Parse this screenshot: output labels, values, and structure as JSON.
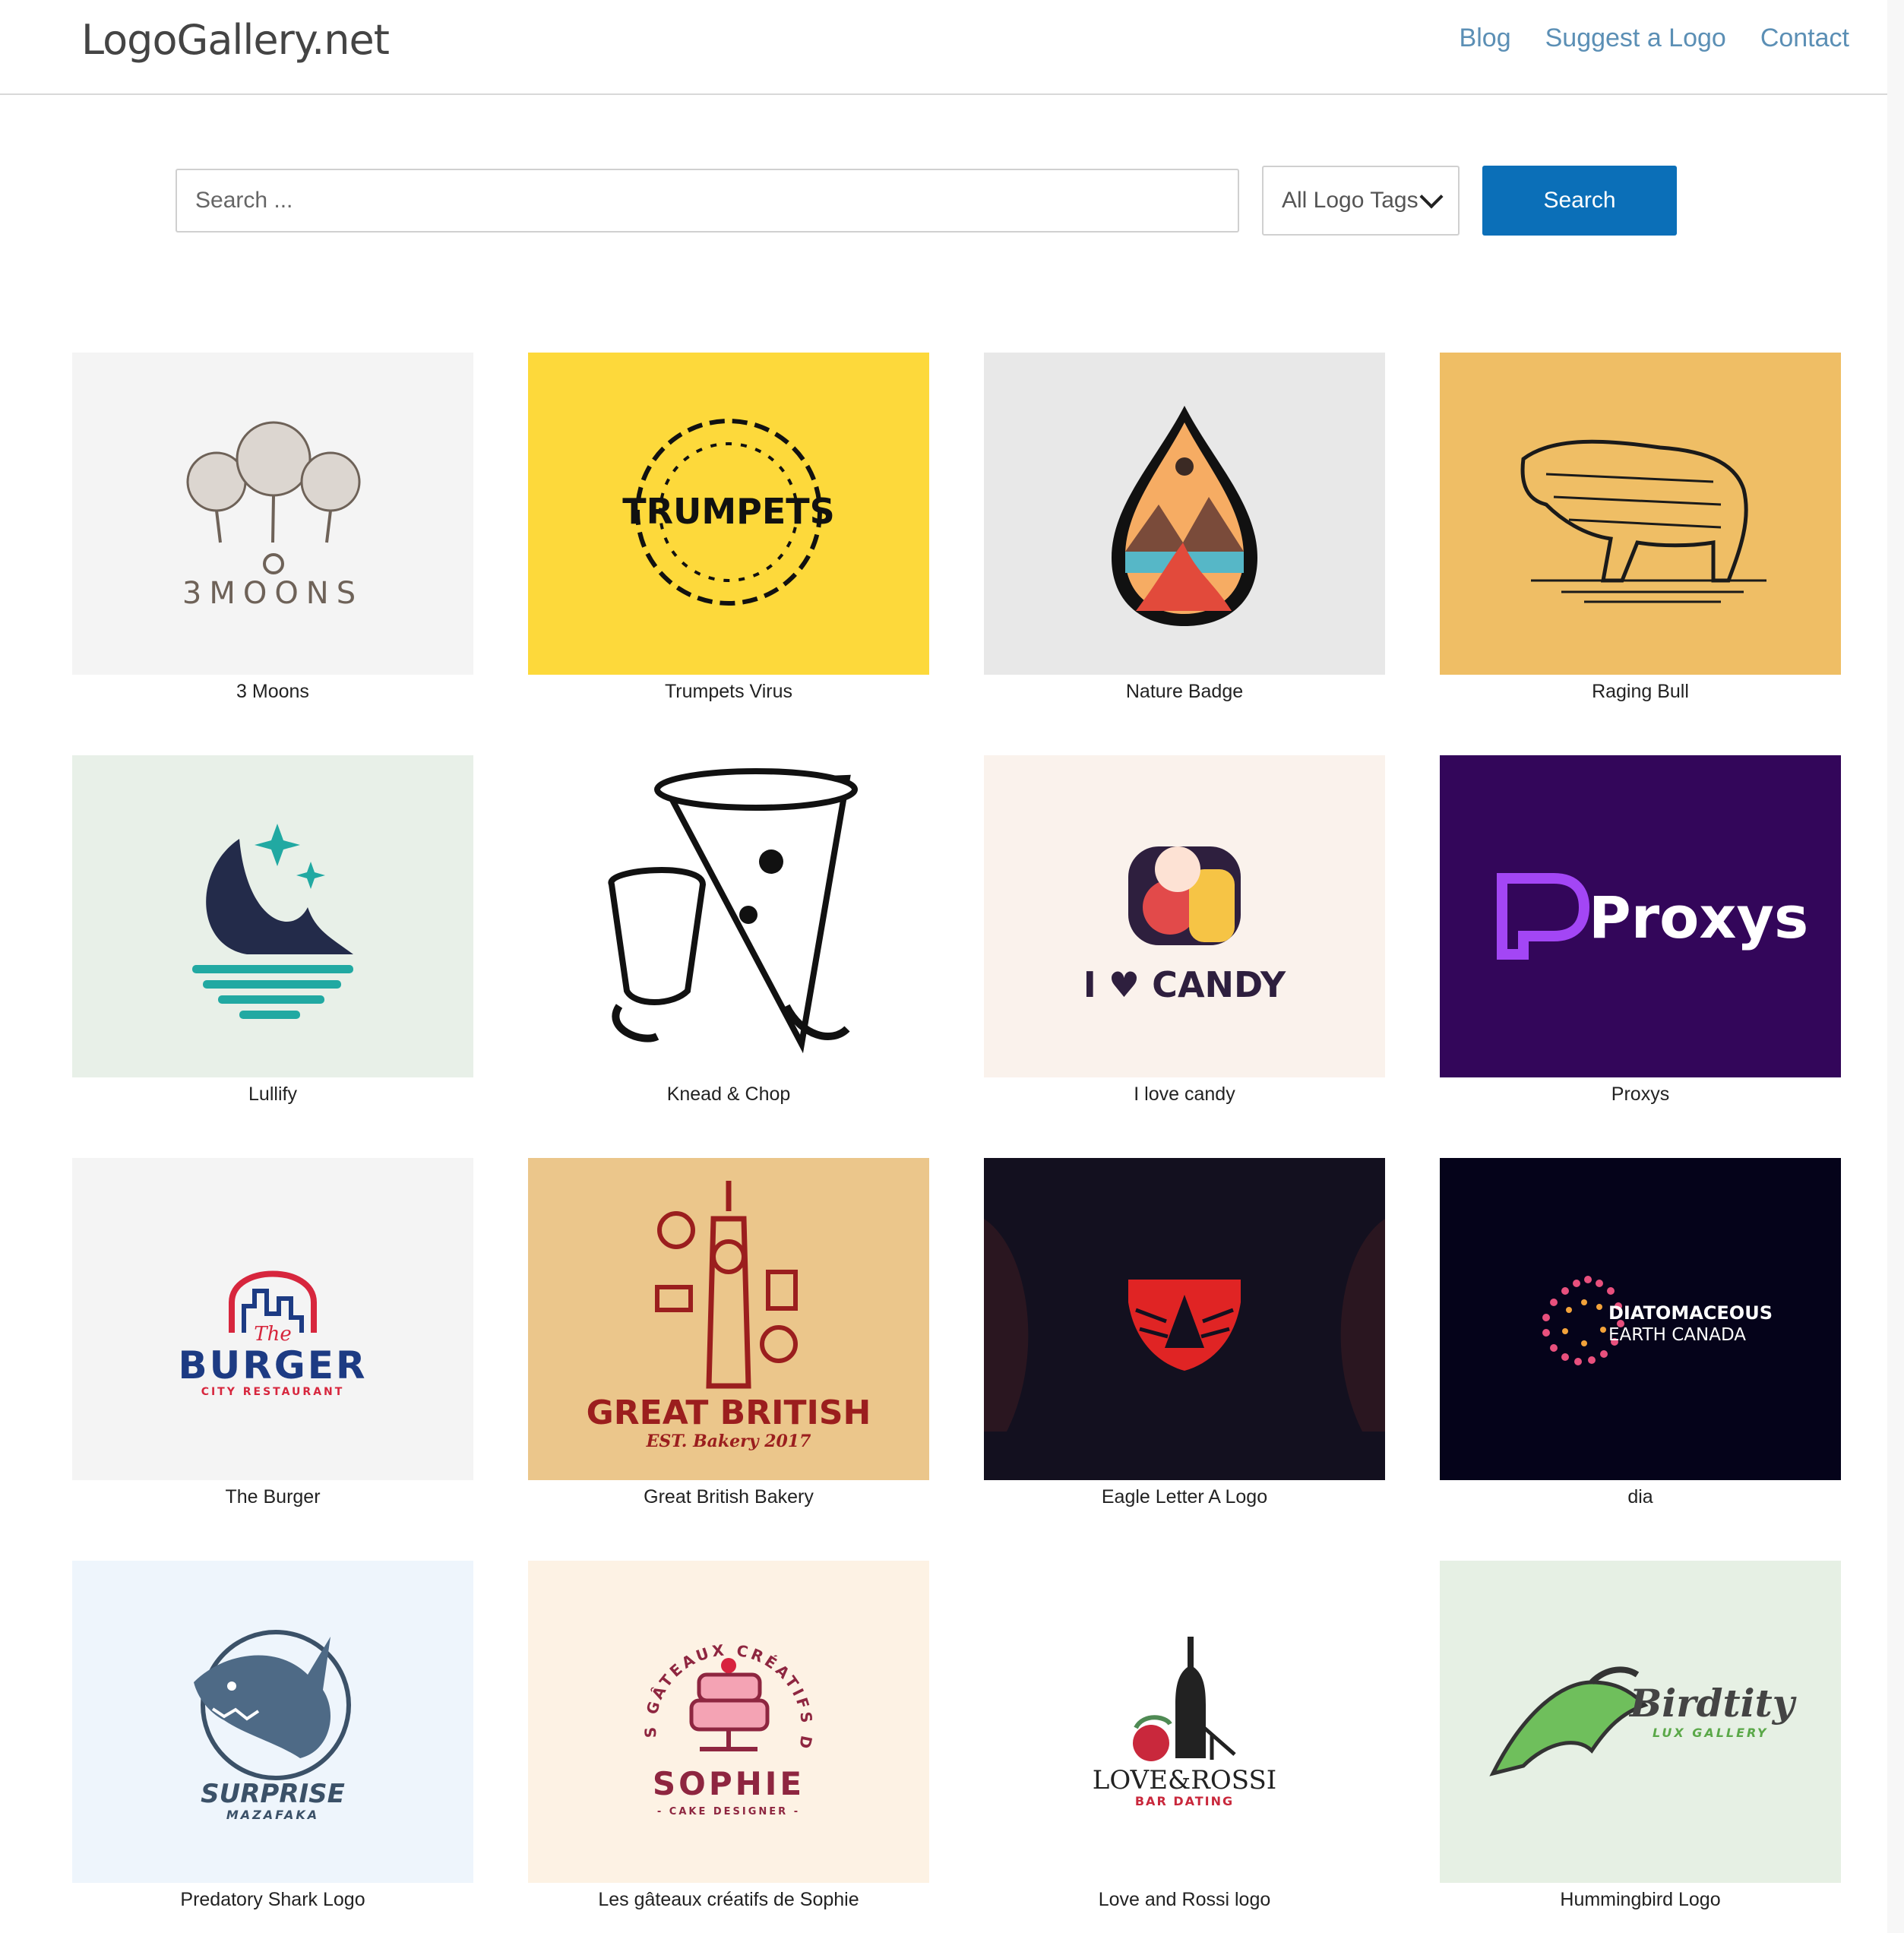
{
  "header": {
    "site_name": "LogoGallery.net",
    "nav": [
      "Blog",
      "Suggest a Logo",
      "Contact"
    ]
  },
  "search": {
    "placeholder": "Search ...",
    "tags_selected": "All Logo Tags",
    "button_label": "Search"
  },
  "logos": [
    {
      "title": "3 Moons",
      "bg": "#f4f4f4",
      "art": "3MOONS"
    },
    {
      "title": "Trumpets Virus",
      "bg": "#fdd93b",
      "art": "TRUMPETS"
    },
    {
      "title": "Nature Badge",
      "bg": "#e8e8e8",
      "art": ""
    },
    {
      "title": "Raging Bull",
      "bg": "#efbe65",
      "art": ""
    },
    {
      "title": "Lullify",
      "bg": "#e8f0e8",
      "art": ""
    },
    {
      "title": "Knead & Chop",
      "bg": "#ffffff",
      "art": ""
    },
    {
      "title": "I love candy",
      "bg": "#faf2ec",
      "art": "I ♥ CANDY"
    },
    {
      "title": "Proxys",
      "bg": "#33065a",
      "art": "Proxys"
    },
    {
      "title": "The Burger",
      "bg": "#f4f4f4",
      "art": "BURGER",
      "art_top": "The",
      "art_sub": "CITY RESTAURANT"
    },
    {
      "title": "Great British Bakery",
      "bg": "#ebc68b",
      "art": "GREAT BRITISH",
      "art_sub": "EST. Bakery 2017"
    },
    {
      "title": "Eagle Letter A Logo",
      "bg": "#13101f",
      "art": ""
    },
    {
      "title": "dia",
      "bg": "#05031a",
      "art": "DIATOMACEOUS",
      "art_sub": "EARTH CANADA"
    },
    {
      "title": "Predatory Shark Logo",
      "bg": "#eef5fc",
      "art": "SURPRISE",
      "art_sub": "MAZAFAKA"
    },
    {
      "title": "Les gâteaux créatifs de Sophie",
      "bg": "#fdf2e4",
      "art": "SOPHIE",
      "art_top": "LES GÂTEAUX CRÉATIFS DE",
      "art_sub": "- CAKE DESIGNER -"
    },
    {
      "title": "Love and Rossi logo",
      "bg": "#ffffff",
      "art": "LOVE&ROSSI",
      "art_sub": "BAR DATING"
    },
    {
      "title": "Hummingbird Logo",
      "bg": "#e6f0e4",
      "art": "Birdtity",
      "art_sub": "LUX GALLERY"
    }
  ],
  "colors": {
    "nav_link": "#5b8fb5",
    "search_button": "#0b6fb8"
  }
}
